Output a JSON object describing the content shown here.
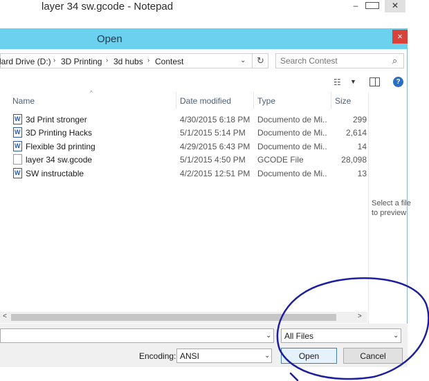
{
  "notepad": {
    "title": "layer 34 sw.gcode - Notepad",
    "minimize": "–",
    "maximize": "",
    "close": "✕"
  },
  "dialog": {
    "title": "Open",
    "close": "×"
  },
  "address": {
    "crumbs": [
      "lard Drive (D:)",
      "3D Printing",
      "3d hubs",
      "Contest"
    ],
    "separator": "›",
    "dropdown": "⌄",
    "refresh": "↻"
  },
  "search": {
    "placeholder": "Search Contest",
    "icon": "⌕"
  },
  "toolbar": {
    "view_icon": "☷",
    "view_arrow": "▼",
    "help": "?"
  },
  "columns": {
    "name": "Name",
    "date": "Date modified",
    "type": "Type",
    "size": "Size",
    "sort": "^"
  },
  "files": [
    {
      "name": "3d Print stronger",
      "date": "4/30/2015 6:18 PM",
      "type": "Documento de Mi...",
      "size": "299",
      "icon": "word"
    },
    {
      "name": "3D Printing Hacks",
      "date": "5/1/2015 5:14 PM",
      "type": "Documento de Mi...",
      "size": "2,614",
      "icon": "word"
    },
    {
      "name": "Flexible 3d printing",
      "date": "4/29/2015 6:43 PM",
      "type": "Documento de Mi...",
      "size": "14",
      "icon": "word"
    },
    {
      "name": "layer 34 sw.gcode",
      "date": "5/1/2015 4:50 PM",
      "type": "GCODE File",
      "size": "28,098",
      "icon": "gcode"
    },
    {
      "name": "SW instructable",
      "date": "4/2/2015 12:51 PM",
      "type": "Documento de Mi...",
      "size": "13",
      "icon": "word"
    }
  ],
  "preview": {
    "text_line1": "Select a file",
    "text_line2": "to preview"
  },
  "scrollbar": {
    "left": "<",
    "right": ">"
  },
  "bottom": {
    "filename_value": "",
    "filetype": "All Files",
    "encoding_label": "Encoding:",
    "encoding_value": "ANSI",
    "dropdown": "⌄",
    "open": "Open",
    "cancel": "Cancel"
  },
  "colors": {
    "dialog_titlebar": "#6bd1ee",
    "close_button": "#d9413b",
    "annotation": "#1c1f9e"
  }
}
